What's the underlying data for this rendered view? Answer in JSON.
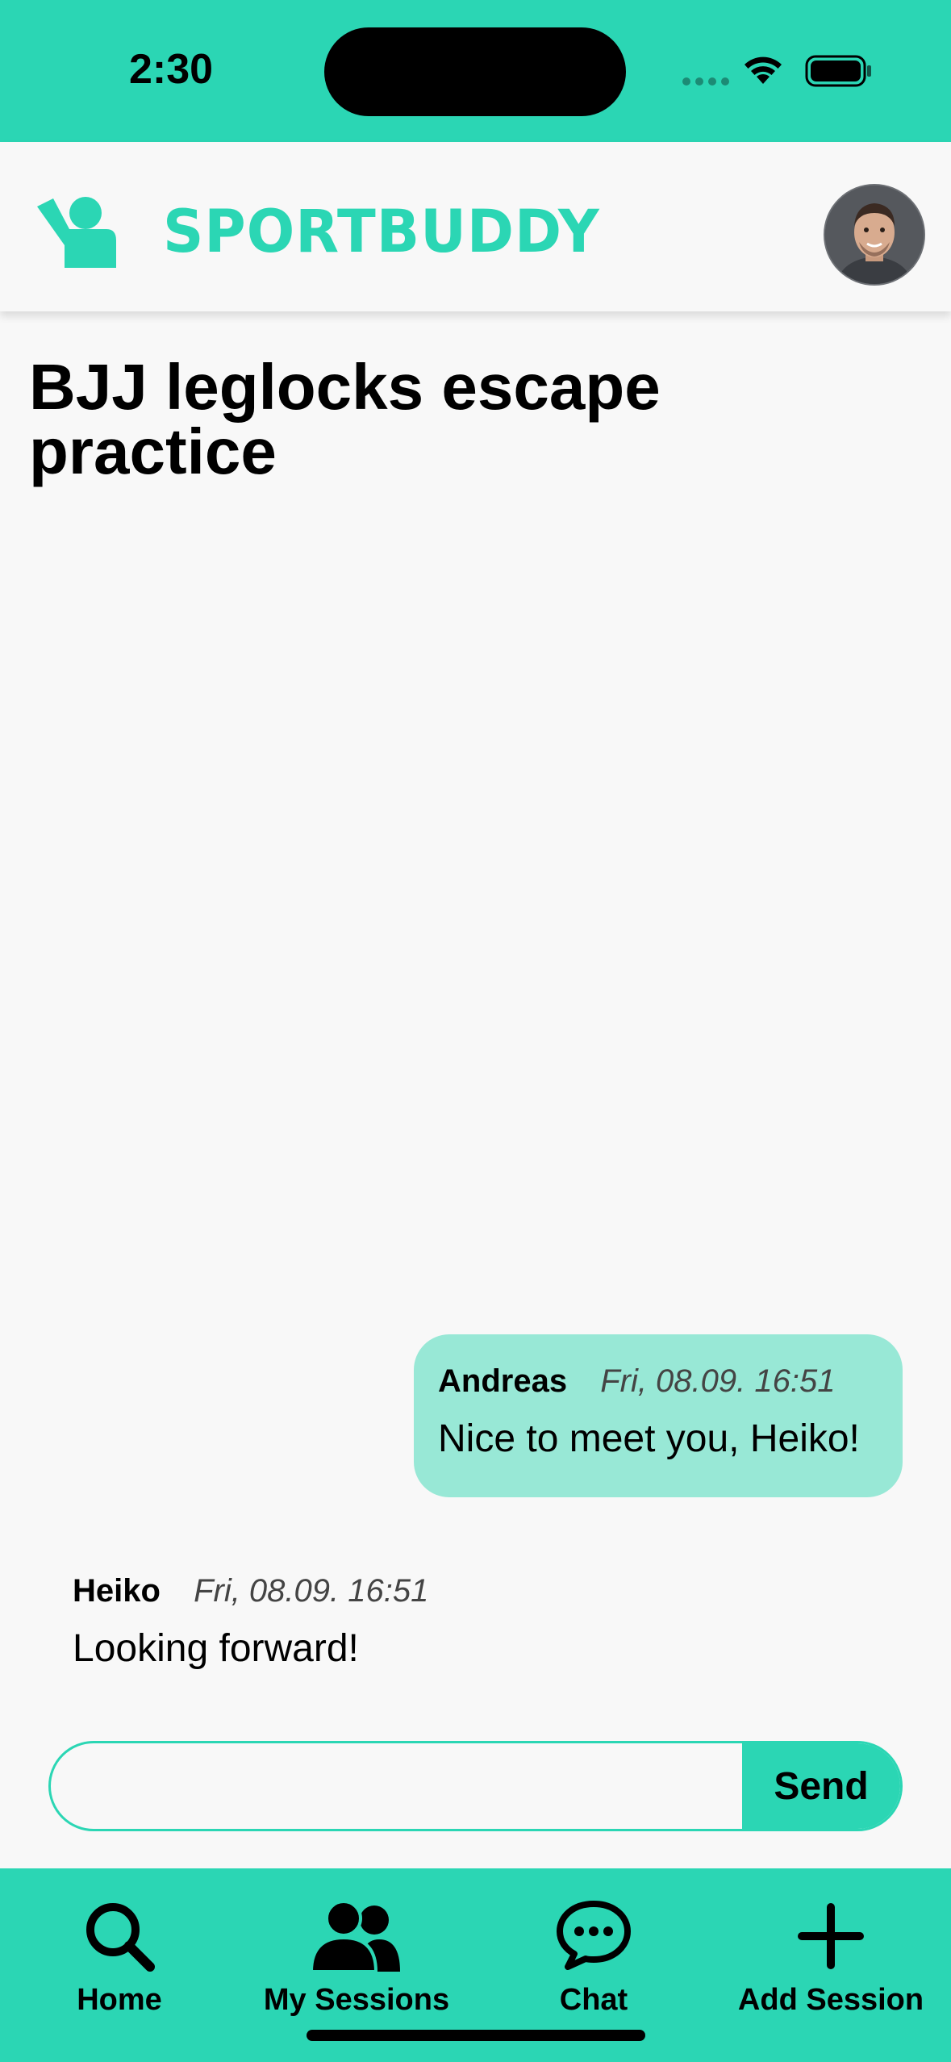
{
  "status_bar": {
    "time": "2:30"
  },
  "header": {
    "brand": "SPORTBUDDY",
    "avatar_icon": "user-avatar"
  },
  "page": {
    "title": "BJJ leglocks escape practice"
  },
  "messages": [
    {
      "author": "Andreas",
      "time": "Fri, 08.09. 16:51",
      "text": "Nice to meet you, Heiko!",
      "own": true
    },
    {
      "author": "Heiko",
      "time": "Fri, 08.09. 16:51",
      "text": "Looking forward!",
      "own": false
    }
  ],
  "composer": {
    "placeholder": "",
    "value": "",
    "send_label": "Send"
  },
  "nav": {
    "items": [
      {
        "label": "Home",
        "icon": "search-icon"
      },
      {
        "label": "My Sessions",
        "icon": "users-icon"
      },
      {
        "label": "Chat",
        "icon": "chat-icon"
      },
      {
        "label": "Add Session",
        "icon": "plus-icon"
      }
    ]
  },
  "colors": {
    "accent": "#2bd6b4",
    "bubble": "#98e8d6",
    "background": "#f8f8f8"
  }
}
